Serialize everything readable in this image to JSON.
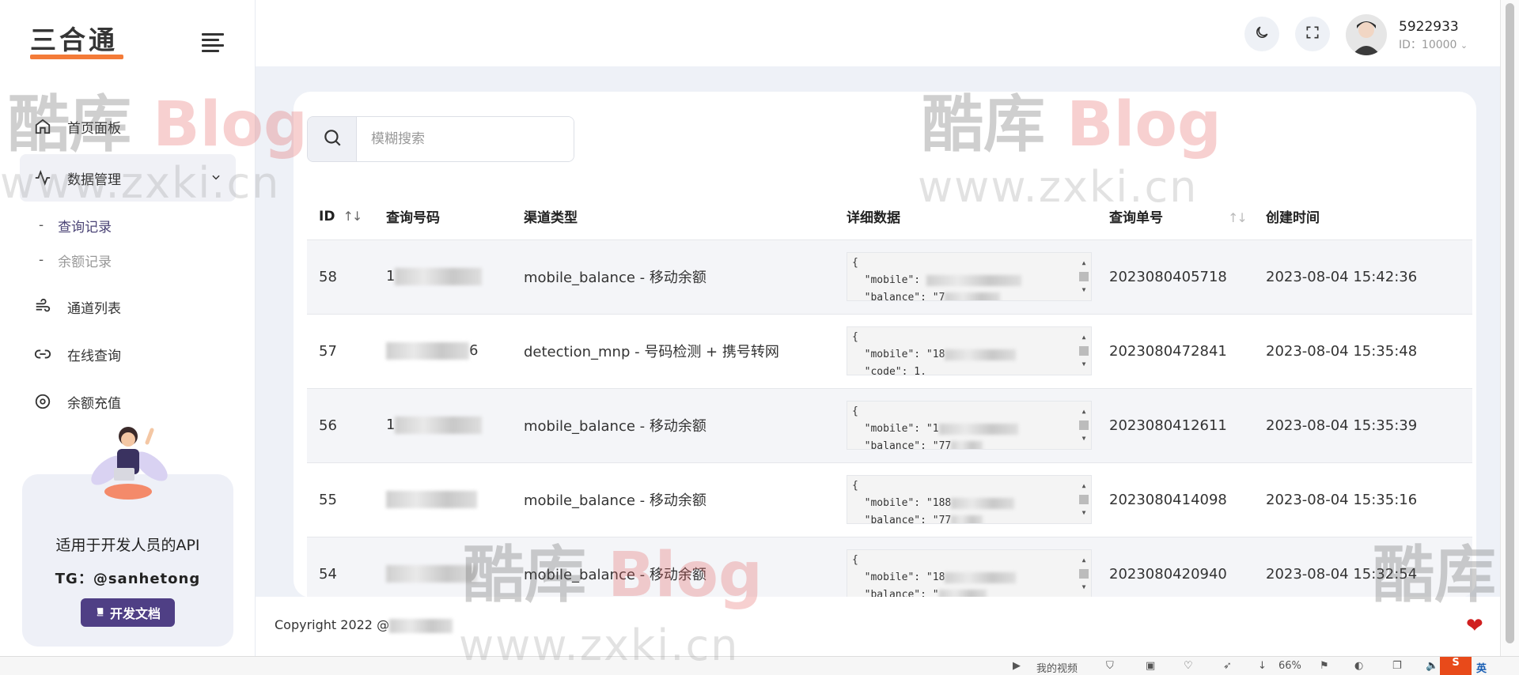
{
  "logo": {
    "text": "三合通"
  },
  "sidebar": {
    "items": [
      {
        "label": "首页面板",
        "icon": "home-icon"
      },
      {
        "label": "数据管理",
        "icon": "activity-icon",
        "active": true
      },
      {
        "label": "通道列表",
        "icon": "wind-icon"
      },
      {
        "label": "在线查询",
        "icon": "link-icon"
      },
      {
        "label": "余额充值",
        "icon": "disc-icon"
      }
    ],
    "subitems": [
      {
        "dash": "-",
        "label": "查询记录",
        "current": true
      },
      {
        "dash": "-",
        "label": "余额记录"
      }
    ],
    "promo": {
      "title": "适用于开发人员的API",
      "tg": "TG：@sanhetong",
      "button": "开发文档"
    }
  },
  "header": {
    "user_name": "5922933",
    "user_id": "ID：10000"
  },
  "search": {
    "placeholder": "模糊搜索"
  },
  "table": {
    "columns": [
      "ID",
      "查询号码",
      "渠道类型",
      "详细数据",
      "查询单号",
      "创建时间"
    ],
    "rows": [
      {
        "id": "58",
        "phone_visible": "1",
        "channel": "mobile_balance - 移动余额",
        "json_line1": "{",
        "json_line2": "  \"mobile\":",
        "json_line3": "  \"balance\": \"7",
        "order": "2023080405718",
        "time": "2023-08-04 15:42:36"
      },
      {
        "id": "57",
        "phone_visible": "6",
        "channel": "detection_mnp - 号码检测 + 携号转网",
        "json_line1": "{",
        "json_line2": "  \"mobile\": \"18",
        "json_line3": "  \"code\": 1,",
        "order": "2023080472841",
        "time": "2023-08-04 15:35:48"
      },
      {
        "id": "56",
        "phone_visible": "1",
        "channel": "mobile_balance - 移动余额",
        "json_line1": "{",
        "json_line2": "  \"mobile\": \"1",
        "json_line3": "  \"balance\": \"77",
        "order": "2023080412611",
        "time": "2023-08-04 15:35:39"
      },
      {
        "id": "55",
        "phone_visible": "",
        "channel": "mobile_balance - 移动余额",
        "json_line1": "{",
        "json_line2": "  \"mobile\": \"188",
        "json_line3": "  \"balance\": \"77",
        "order": "2023080414098",
        "time": "2023-08-04 15:35:16"
      },
      {
        "id": "54",
        "phone_visible": "",
        "channel": "mobile_balance - 移动余额",
        "json_line1": "{",
        "json_line2": "  \"mobile\": \"18",
        "json_line3": "  \"balance\": \"",
        "order": "2023080420940",
        "time": "2023-08-04 15:32:54"
      }
    ]
  },
  "footer": {
    "copyright": "Copyright 2022 @"
  },
  "statusbar": {
    "video": "我的视频",
    "zoom": "66%",
    "ime": "英"
  },
  "watermark": {
    "cn": "酷库",
    "blog": "Blog",
    "url": "www.zxki.cn"
  },
  "colors": {
    "accent": "#4f3f85",
    "logo_bar": "#f47b38",
    "heart": "#d01f1f"
  }
}
